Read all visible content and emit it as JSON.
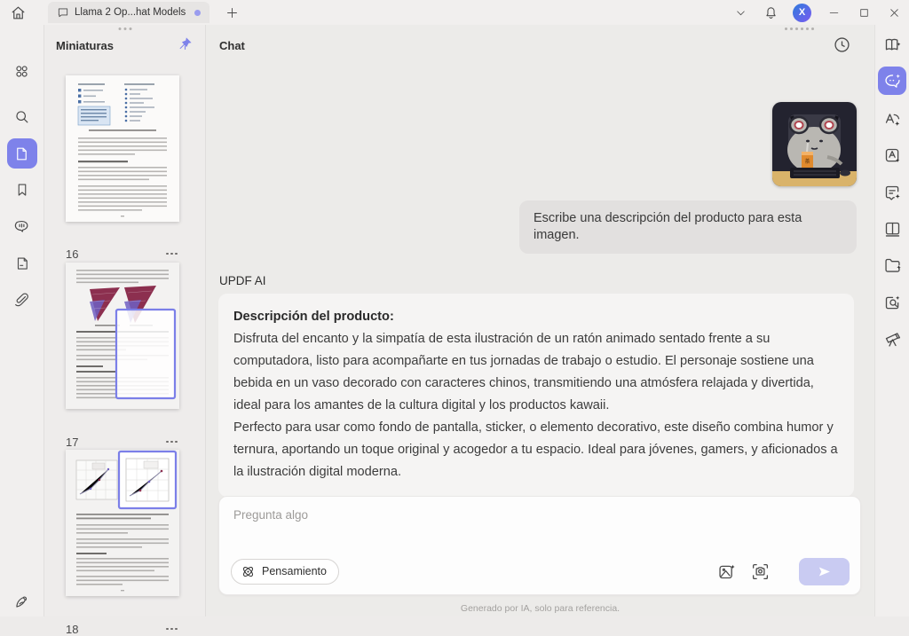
{
  "accent": "#7e82ea",
  "titlebar": {
    "tab_title": "Llama 2 Op...hat Models",
    "avatar_initial": "X"
  },
  "left_panel": {
    "title": "Miniaturas",
    "pages": [
      {
        "number": "16"
      },
      {
        "number": "17"
      },
      {
        "number": "18"
      }
    ]
  },
  "chat": {
    "header": "Chat",
    "user_message": "Escribe una descripción del producto para esta imagen.",
    "ai_label": "UPDF AI",
    "response": {
      "heading": "Descripción del producto:",
      "paragraph1": "Disfruta del encanto y la simpatía de esta ilustración de un ratón animado sentado frente a su computadora, listo para acompañarte en tus jornadas de trabajo o estudio. El personaje sostiene una bebida en un vaso decorado con caracteres chinos, transmitiendo una atmósfera relajada y divertida, ideal para los amantes de la cultura digital y los productos kawaii.",
      "paragraph2": "Perfecto para usar como fondo de pantalla, sticker, o elemento decorativo, este diseño combina humor y ternura, aportando un toque original y acogedor a tu espacio. Ideal para jóvenes, gamers, y aficionados a la ilustración digital moderna."
    },
    "input": {
      "placeholder": "Pregunta algo",
      "thinking_label": "Pensamiento"
    },
    "disclaimer": "Generado por IA, solo para referencia."
  }
}
